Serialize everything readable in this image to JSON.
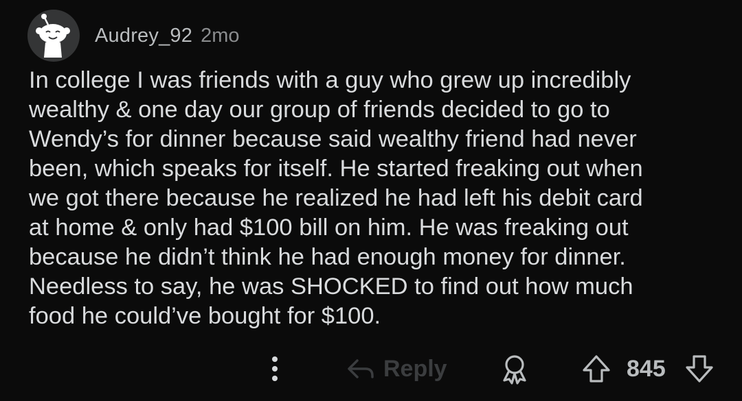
{
  "comment": {
    "username": "Audrey_92",
    "timestamp": "2mo",
    "body": "In college I was friends with a guy who grew up incredibly\nwealthy & one day our group of friends decided to go to\nWendy’s for dinner because said wealthy friend had never\nbeen, which speaks for itself. He started freaking out when\nwe got there because he realized he had left his debit card\nat home & only had $100 bill on him. He was freaking out\nbecause he didn’t think he had enough money for dinner.\nNeedless to say, he was SHOCKED to find out how much\nfood he could’ve bought for $100.",
    "avatar_icon": "snoo-avatar-icon"
  },
  "actions": {
    "more_icon": "more-vertical-icon",
    "reply_label": "Reply",
    "reply_icon": "reply-arrow-icon",
    "award_icon": "award-icon",
    "upvote_icon": "upvote-arrow-icon",
    "score": "845",
    "downvote_icon": "downvote-arrow-icon"
  },
  "colors": {
    "background": "#0b0b0b",
    "text": "#d9dbdd",
    "muted": "#8a8c8e",
    "disabled": "#3b3d3f"
  }
}
